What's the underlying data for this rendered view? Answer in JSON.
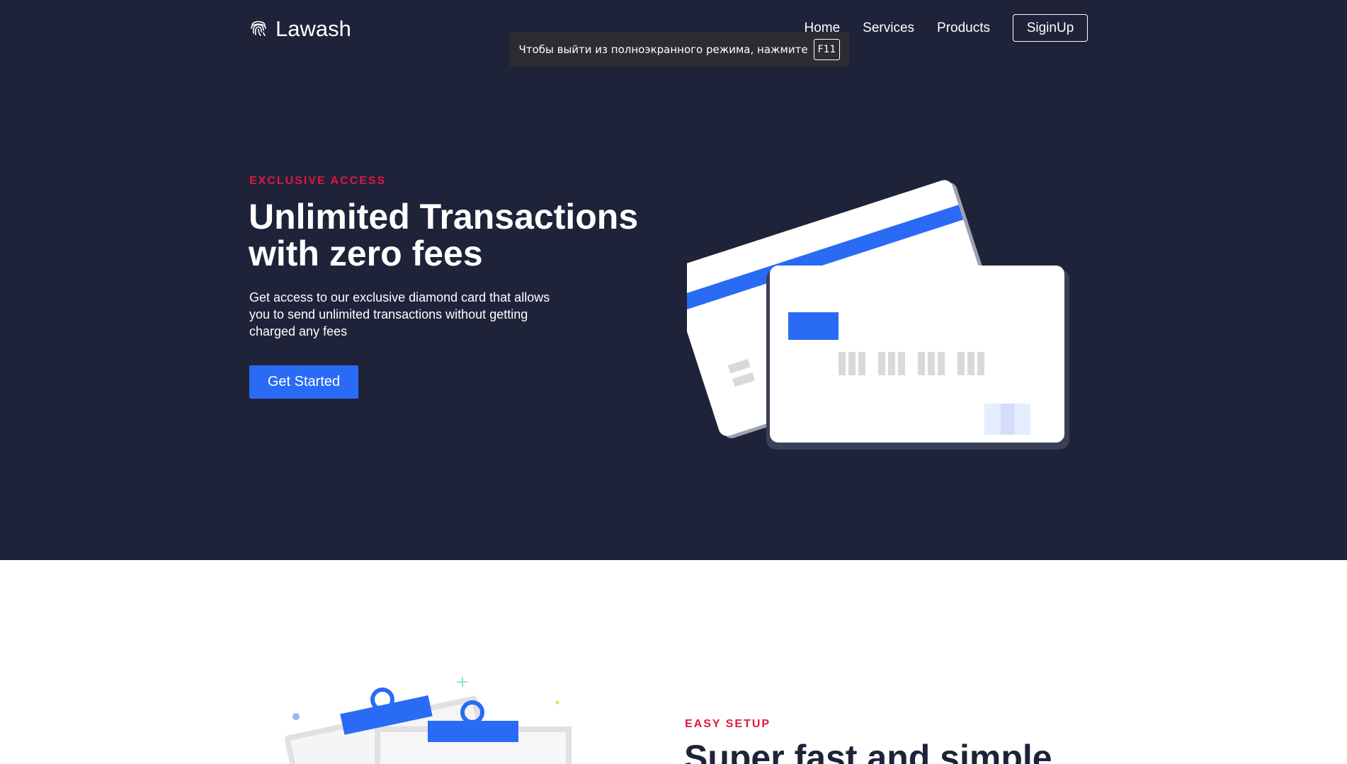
{
  "brand": {
    "name": "Lawash",
    "logo_icon": "fingerprint-icon"
  },
  "nav": {
    "links": [
      "Home",
      "Services",
      "Products"
    ],
    "signup_label": "SiginUp"
  },
  "fullscreen_notice": {
    "text": "Чтобы выйти из полноэкранного режима, нажмите",
    "key": "F11"
  },
  "hero": {
    "eyebrow": "EXCLUSIVE ACCESS",
    "title_line1": "Unlimited Transactions",
    "title_line2": "with zero fees",
    "description": "Get access to our exclusive diamond card that allows you to send unlimited transactions without getting charged any fees",
    "cta_label": "Get Started"
  },
  "section2": {
    "eyebrow": "EASY SETUP",
    "title": "Super fast and simple"
  },
  "colors": {
    "hero_bg": "#1f2339",
    "accent": "#2a6bf5",
    "eyebrow": "#e0163f"
  }
}
